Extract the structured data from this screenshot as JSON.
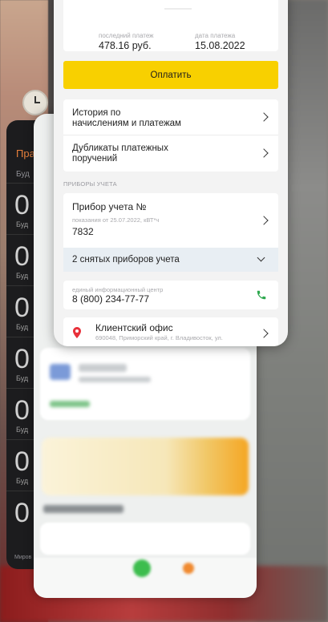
{
  "background": {
    "alarm_app": {
      "title": "Пра",
      "subtitle": "Буд",
      "rows": [
        {
          "time": "0",
          "label": "Буд"
        },
        {
          "time": "0",
          "label": "Буд"
        },
        {
          "time": "0",
          "label": "Буд"
        },
        {
          "time": "0",
          "label": "Буд"
        },
        {
          "time": "0",
          "label": "Буд"
        },
        {
          "time": "0",
          "label": "Буд"
        },
        {
          "time": "0",
          "label": ""
        }
      ],
      "bottom_label": "Миров"
    }
  },
  "payment": {
    "last_payment_label": "последний платеж",
    "last_payment_value": "478.16 руб.",
    "date_label": "дата платежа",
    "date_value": "15.08.2022",
    "pay_button": "Оплатить"
  },
  "menu": {
    "history": "История по начислениям и платежам",
    "history_line1": "История по",
    "history_line2": "начислениям и платежам",
    "duplicates_line1": "Дубликаты платежных",
    "duplicates_line2": "поручений"
  },
  "meters": {
    "section_label": "ПРИБОРЫ УЧЕТА",
    "meter_title": "Прибор учета №",
    "reading_label": "показания от 25.07.2022, кВТ*ч",
    "reading_value": "7832",
    "collapsed_label": "2 снятых приборов учета"
  },
  "contact": {
    "center_label": "единый информационный центр",
    "phone": "8 (800) 234-77-77"
  },
  "office": {
    "title": "Клиентский офис",
    "address": "690048, Приморский край, г. Владивосток, ул."
  },
  "colors": {
    "accent_yellow": "#f8d000",
    "phone_green": "#2fa84f",
    "pin_red": "#e8303a"
  },
  "icons": [
    "clock-icon",
    "chevron-right-icon",
    "chevron-down-icon",
    "phone-icon",
    "location-pin-icon"
  ]
}
